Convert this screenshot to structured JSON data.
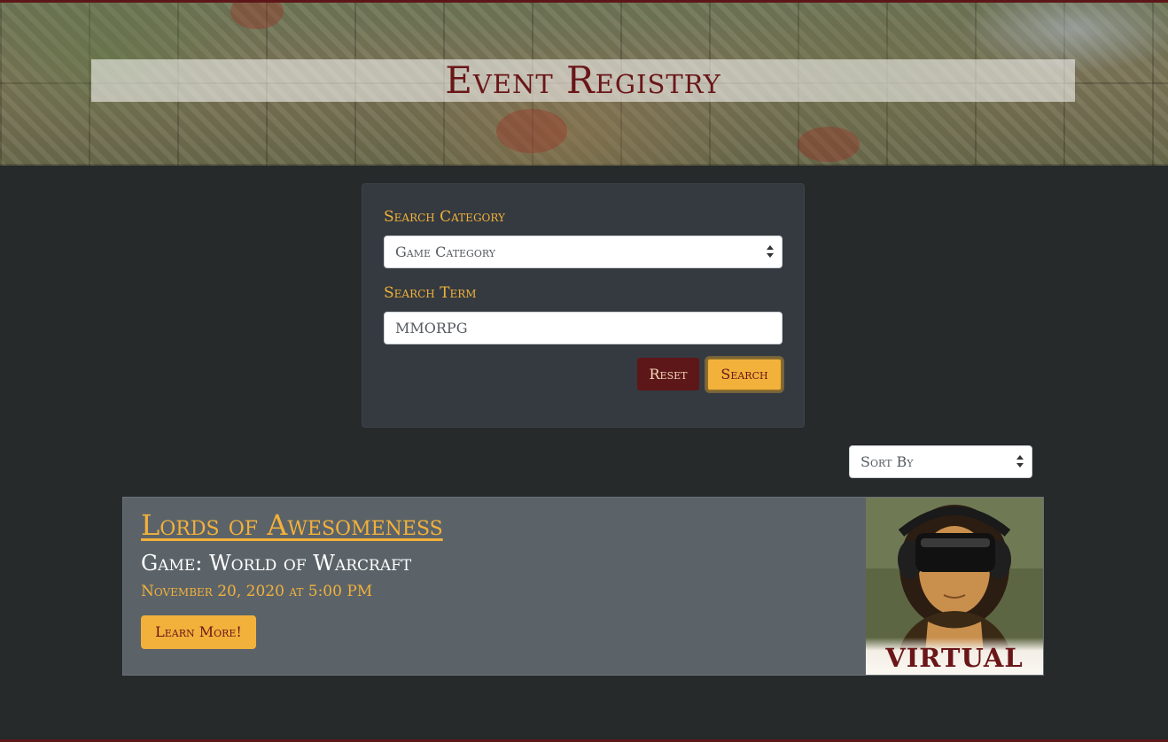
{
  "header": {
    "title": "Event Registry"
  },
  "search": {
    "category_label": "Search Category",
    "category_selected": "Game Category",
    "term_label": "Search Term",
    "term_value": "MMORPG",
    "reset_label": "Reset",
    "search_label": "Search"
  },
  "sort": {
    "selected": "Sort By"
  },
  "events": [
    {
      "title": "Lords of Awesomeness",
      "game": "Game: World of Warcraft",
      "date": "November 20, 2020 at 5:00 PM",
      "learn_more_label": "Learn More!",
      "image_caption": "VIRTUAL"
    }
  ],
  "colors": {
    "accent_gold": "#f2b13a",
    "maroon": "#5e1719",
    "background": "#262a2b",
    "card": "#5b6369"
  },
  "icons": {
    "select_arrow": "select-arrows-icon"
  }
}
